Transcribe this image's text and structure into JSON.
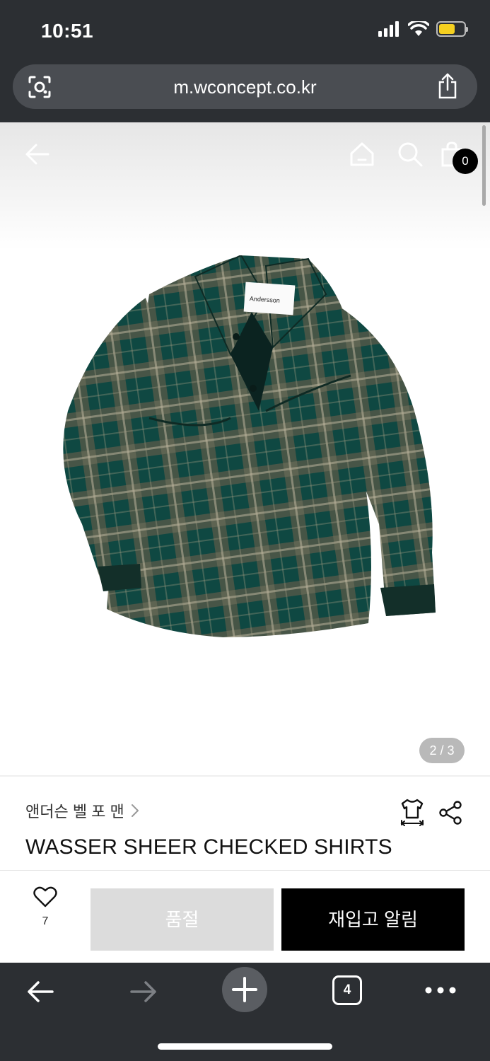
{
  "status_bar": {
    "time": "10:51"
  },
  "browser": {
    "url": "m.wconcept.co.kr",
    "tab_count": "4"
  },
  "site_header": {
    "cart_count": "0"
  },
  "gallery": {
    "indicator": "2 / 3"
  },
  "product": {
    "brand": "앤더슨 벨 포 맨",
    "name": "WASSER SHEER CHECKED SHIRTS",
    "label_text": "Andersson"
  },
  "actions": {
    "like_count": "7",
    "soldout_label": "품절",
    "restock_label": "재입고 알림"
  },
  "colors": {
    "browser_chrome": "#2c2f33",
    "battery": "#f5d020",
    "shirt_green": "#1f3d35",
    "primary_button": "#000000",
    "disabled_button": "#dcdcdc"
  }
}
